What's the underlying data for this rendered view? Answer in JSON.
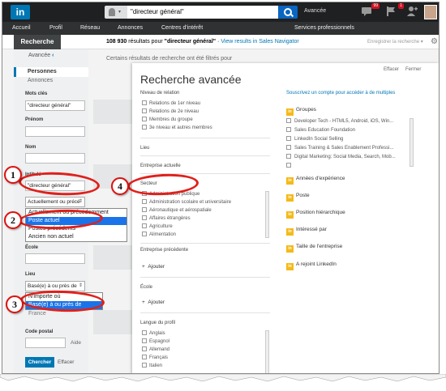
{
  "header": {
    "logo": "in",
    "search_value": "\"directeur général\"",
    "advanced_link": "Avancée",
    "badges": {
      "messages": "99",
      "notifications": "1"
    }
  },
  "nav": [
    "Accueil",
    "Profil",
    "Réseau",
    "Annonces",
    "Centres d'intérêt",
    "Services professionnels"
  ],
  "subheader": {
    "tab": "Recherche",
    "results_count": "108 930",
    "results_text": "résultats pour",
    "results_query": "\"directeur général\"",
    "sales_link": "View results in Sales Navigator",
    "save_search": "Enregistrer la recherche",
    "filtered_note": "Certains résultats de recherche ont été filtrés pour"
  },
  "left": {
    "avancee": "Avancée",
    "people": "Personnes",
    "companies": "Annonces",
    "keywords_label": "Mots clés",
    "keywords_value": "\"directeur général\"",
    "firstname_label": "Prénom",
    "lastname_label": "Nom",
    "title_label": "Intitulé",
    "title_value": "\"directeur général\"",
    "title_select": "Actuellement ou précé",
    "title_options": [
      "Actuellement ou précédemment",
      "Poste actuel",
      "Postes précédents",
      "Ancien non actuel"
    ],
    "school_label": "École",
    "location_label": "Lieu",
    "location_select": "Basé(e) à ou près de",
    "location_options": [
      "N'importe où",
      "Basé(e) à ou près de"
    ],
    "location_behind": "France",
    "postcode_label": "Code postal",
    "help": "Aide",
    "search_btn": "Chercher",
    "clear": "Effacer"
  },
  "modal": {
    "title": "Recherche avancée",
    "clear": "Effacer",
    "close": "Fermer",
    "relation_label": "Niveau de relation",
    "relations": [
      "Relations de 1er niveau",
      "Relations de 2e niveau",
      "Membres du groupe",
      "3e niveau et autres membres"
    ],
    "location_label": "Lieu",
    "current_company": "Entreprise actuelle",
    "sector_label": "Secteur",
    "sectors": [
      "Administration publique",
      "Administration scolaire et universitaire",
      "Aéronautique et aérospatiale",
      "Affaires étrangères",
      "Agriculture",
      "Alimentation"
    ],
    "past_company": "Entreprise précédente",
    "add": "Ajouter",
    "school_label": "École",
    "profile_language": "Langue du profil",
    "languages": [
      "Anglais",
      "Espagnol",
      "Allemand",
      "Français",
      "Italien"
    ],
    "premium_link": "Souscrivez un compte pour accéder à de multiples",
    "groups": "Groupes",
    "group_items": [
      "Developer Tech - HTML5, Android, iOS, Win...",
      "Sales Education Foundation",
      "LinkedIn Social Selling",
      "Sales Training & Sales Enablement Professi...",
      "Digital Marketing: Social Media, Search, Mob...",
      ""
    ],
    "premium_filters": [
      "Années d'expérience",
      "Poste",
      "Position hiérarchique",
      "Intéressé par",
      "Taille de l'entreprise",
      "A rejoint LinkedIn"
    ],
    "premium_badge": "in"
  },
  "annotations": [
    "1",
    "2",
    "3",
    "4"
  ],
  "colors": {
    "brand": "#0077b5",
    "annotation": "#e0201b",
    "premium": "#f5b919"
  }
}
